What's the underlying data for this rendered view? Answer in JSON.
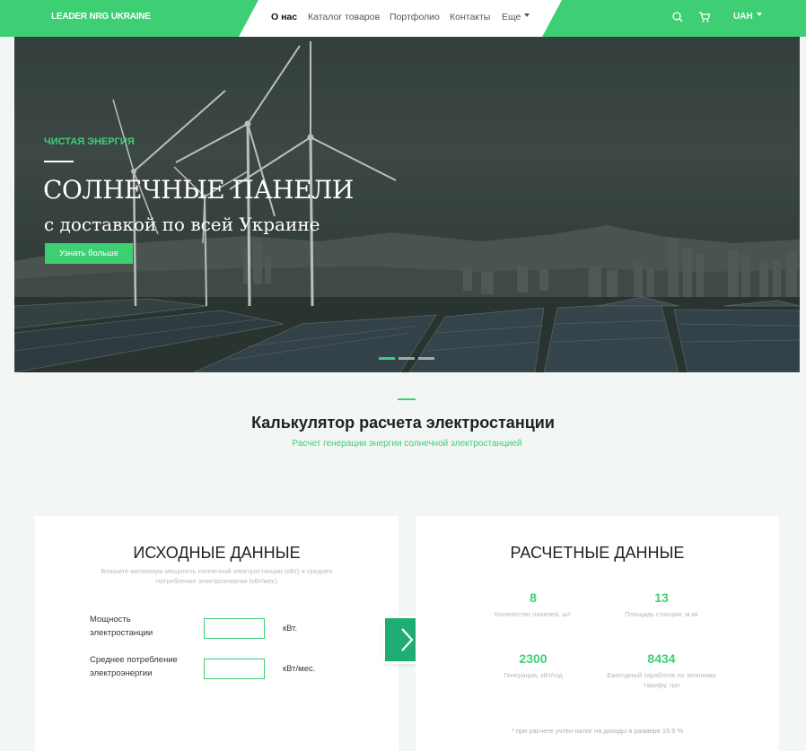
{
  "header": {
    "logo": "LEADER NRG UKRAINE",
    "nav": [
      "О нас",
      "Каталог товаров",
      "Портфолио",
      "Контакты",
      "Еще"
    ],
    "currency": "UAH",
    "icons": [
      "search-icon",
      "cart-icon"
    ]
  },
  "hero": {
    "tag": "ЧИСТАЯ ЭНЕРГИЯ",
    "title": "СОЛНЕЧНЫЕ ПАНЕЛИ",
    "subtitle": "с доставкой по всей Украине",
    "button": "Узнать больше",
    "slides": 3,
    "active_slide": 1
  },
  "calculator": {
    "title": "Калькулятор расчета электростанции",
    "subtitle": "Расчет генерации энергии солнечной электростанцией",
    "input_card": {
      "title": "ИСХОДНЫЕ ДАННЫЕ",
      "description": "Впишите желаемую мощность солнечной электростанции (кВт) и среднее потребление электроэнергии (кВт/мес)",
      "fields": [
        {
          "label": "Мощность электростанции",
          "value": "",
          "unit": "кВт."
        },
        {
          "label": "Среднее потребление электроэнергии",
          "value": "",
          "unit": "кВт/мес."
        }
      ]
    },
    "result_card": {
      "title": "РАСЧЕТНЫЕ ДАННЫЕ",
      "results": [
        {
          "value": "8",
          "label": "Количество панелей, шт."
        },
        {
          "value": "13",
          "label": "Площадь станции, м.кв"
        },
        {
          "value": "2300",
          "label": "Генерация, кВт/год"
        },
        {
          "value": "8434",
          "label": "Ежегодный заработок по зеленому тарифу, грн"
        }
      ],
      "note": "* при расчете учтен налог на доходы в размере 19.5 %"
    }
  },
  "colors": {
    "accent": "#3ecf75",
    "arrow": "#1fae71",
    "background": "#f2f6f5"
  }
}
